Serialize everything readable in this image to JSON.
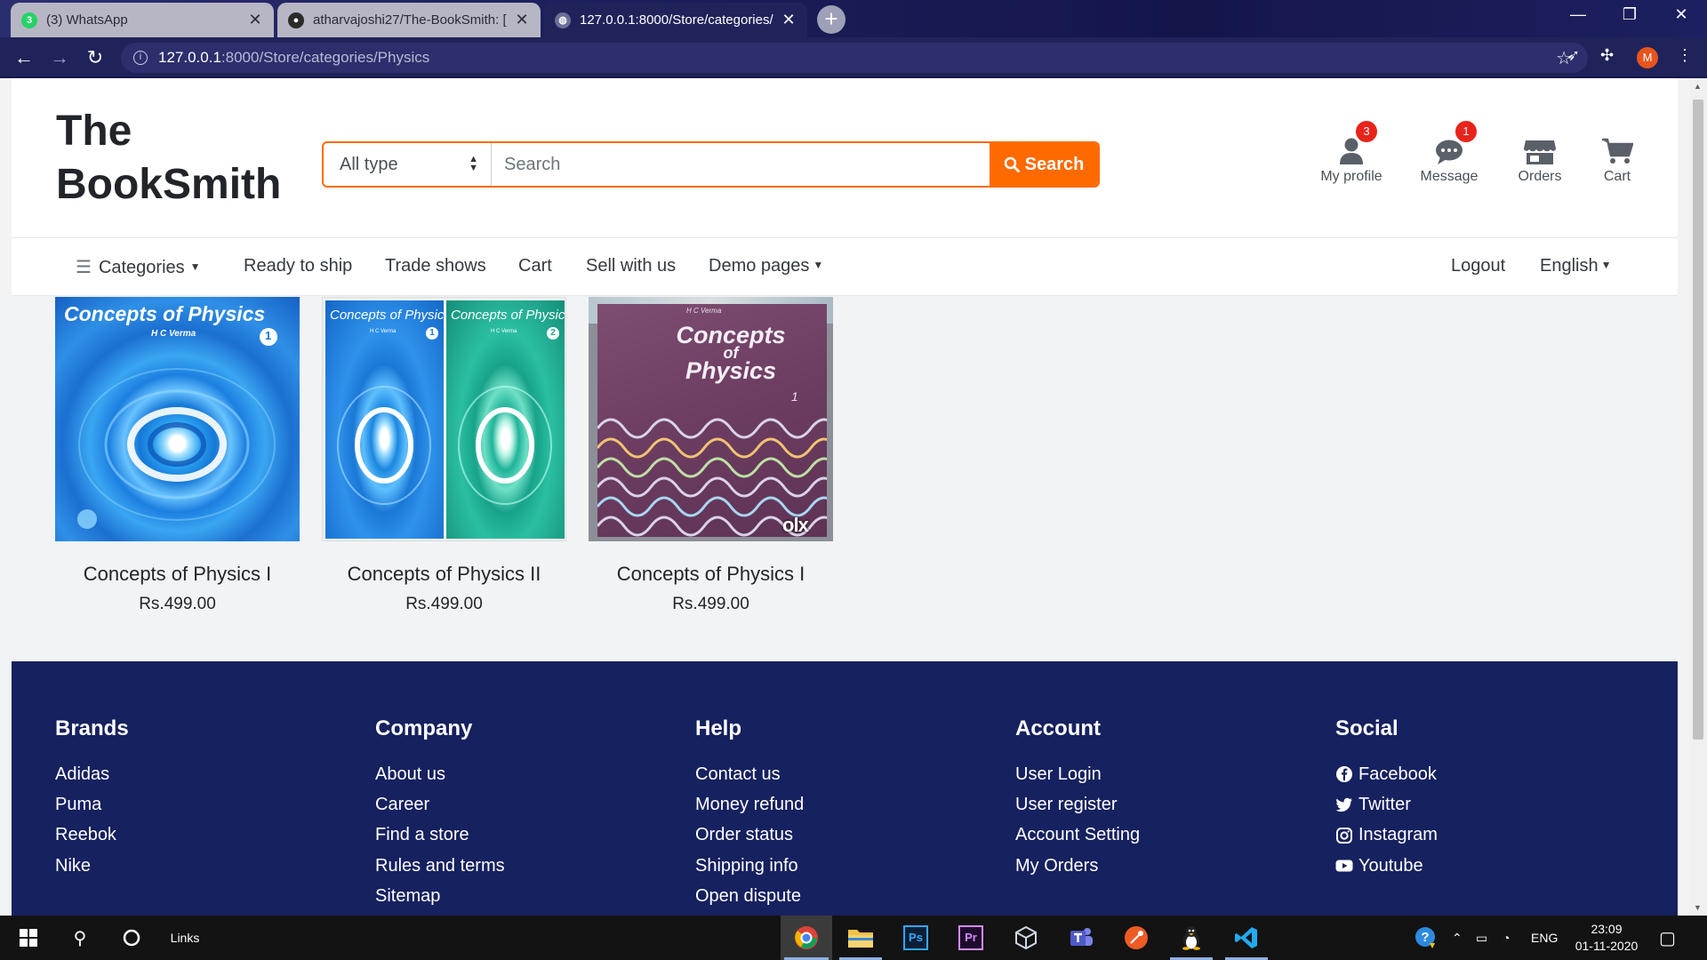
{
  "browser": {
    "tabs": [
      {
        "title": "(3) WhatsApp",
        "icon": "whatsapp-icon"
      },
      {
        "title": "atharvajoshi27/The-BookSmith: [",
        "icon": "github-icon"
      },
      {
        "title": "127.0.0.1:8000/Store/categories/",
        "icon": "globe-icon"
      }
    ],
    "url_host": "127.0.0.1",
    "url_path": ":8000/Store/categories/Physics",
    "profile_initial": "M"
  },
  "site": {
    "brand_line1": "The",
    "brand_line2": "BookSmith",
    "search": {
      "type_selected": "All type",
      "placeholder": "Search",
      "button_label": "Search"
    },
    "header_icons": [
      {
        "label": "My profile",
        "icon": "user-icon",
        "badge": "3"
      },
      {
        "label": "Message",
        "icon": "chat-icon",
        "badge": "1"
      },
      {
        "label": "Orders",
        "icon": "store-icon",
        "badge": ""
      },
      {
        "label": "Cart",
        "icon": "cart-icon",
        "badge": ""
      }
    ],
    "nav": {
      "categories": "Categories",
      "ready_to_ship": "Ready to ship",
      "trade_shows": "Trade shows",
      "cart": "Cart",
      "sell_with_us": "Sell with us",
      "demo_pages": "Demo pages",
      "logout": "Logout",
      "language": "English"
    },
    "products": [
      {
        "title": "Concepts of Physics I",
        "price": "Rs.499.00",
        "cover_text": "Concepts of Physics",
        "cover_author": "H C Verma",
        "cover_volume": "1"
      },
      {
        "title": "Concepts of Physics II",
        "price": "Rs.499.00",
        "cover_text": "Concepts of Physics",
        "cover_author": "H C Verma",
        "cover_volume": "1",
        "cover_volume_2": "2"
      },
      {
        "title": "Concepts of Physics I",
        "price": "Rs.499.00",
        "cover_text_1": "Concepts",
        "cover_text_2": "of",
        "cover_text_3": "Physics",
        "cover_author": "H C Verma",
        "cover_volume": "1",
        "watermark": "olx"
      }
    ],
    "footer": {
      "brands": {
        "title": "Brands",
        "items": [
          "Adidas",
          "Puma",
          "Reebok",
          "Nike"
        ]
      },
      "company": {
        "title": "Company",
        "items": [
          "About us",
          "Career",
          "Find a store",
          "Rules and terms",
          "Sitemap"
        ]
      },
      "help": {
        "title": "Help",
        "items": [
          "Contact us",
          "Money refund",
          "Order status",
          "Shipping info",
          "Open dispute"
        ]
      },
      "account": {
        "title": "Account",
        "items": [
          "User Login",
          "User register",
          "Account Setting",
          "My Orders"
        ]
      },
      "social": {
        "title": "Social",
        "items": [
          "Facebook",
          "Twitter",
          "Instagram",
          "Youtube"
        ]
      }
    }
  },
  "taskbar": {
    "search_label": "Links",
    "language": "ENG",
    "time": "23:09",
    "date": "01-11-2020"
  },
  "colors": {
    "accent": "#ff6a00",
    "footer_bg": "#16215f",
    "badge": "#e8231a"
  }
}
